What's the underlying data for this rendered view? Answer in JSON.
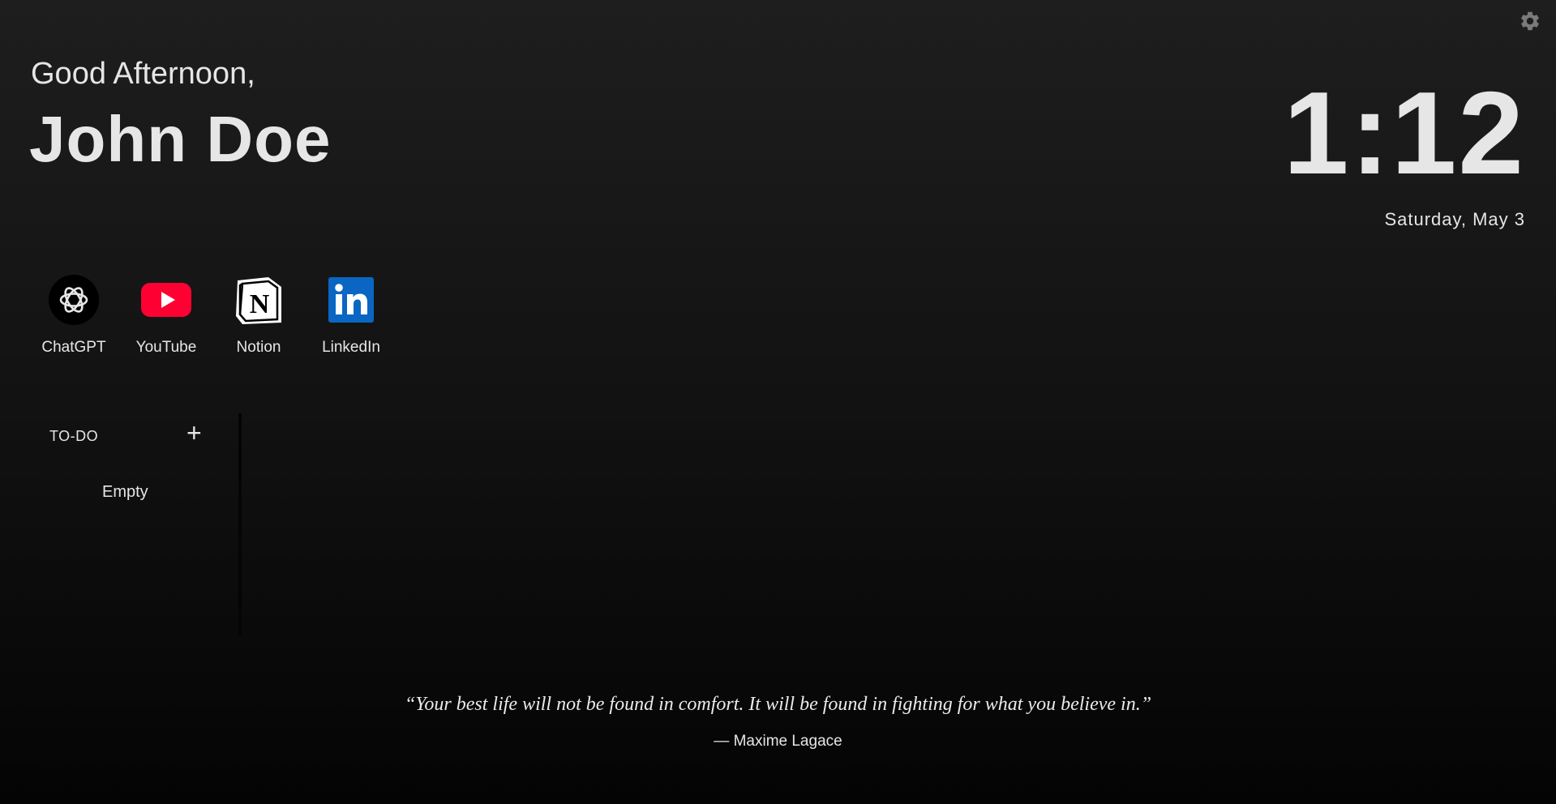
{
  "header": {
    "greeting": "Good Afternoon,",
    "name": "John Doe"
  },
  "clock": {
    "time": "1:12",
    "date": "Saturday, May 3"
  },
  "shortcuts": [
    {
      "label": "ChatGPT",
      "icon": "chatgpt-icon"
    },
    {
      "label": "YouTube",
      "icon": "youtube-icon",
      "color": "#ff0033"
    },
    {
      "label": "Notion",
      "icon": "notion-icon"
    },
    {
      "label": "LinkedIn",
      "icon": "linkedin-icon",
      "color": "#0a66c2"
    }
  ],
  "todo": {
    "title": "TO-DO",
    "add_label": "+",
    "empty_text": "Empty"
  },
  "quote": {
    "text": "“Your best life will not be found in comfort. It will be found in fighting for what you believe in.”",
    "author": "— Maxime Lagace"
  },
  "settings": {
    "icon": "gear-icon"
  }
}
